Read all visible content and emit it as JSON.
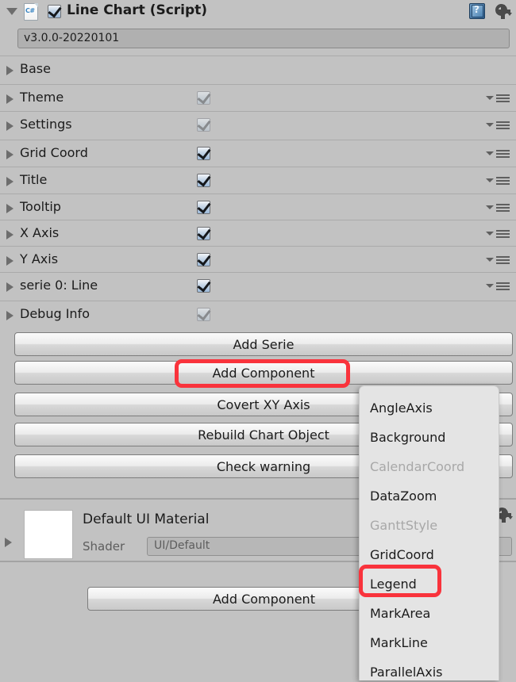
{
  "component": {
    "title": "Line Chart (Script)",
    "script_icon": "csharp-script-icon",
    "enabled": true,
    "help_icon": "help-book-icon",
    "settings_icon": "gear-icon",
    "version": "v3.0.0-20220101"
  },
  "foldouts": [
    {
      "label": "Base",
      "has_checkbox": false,
      "checked": false,
      "dim": false,
      "has_menu": false
    },
    {
      "label": "Theme",
      "has_checkbox": true,
      "checked": true,
      "dim": true,
      "has_menu": true
    },
    {
      "label": "Settings",
      "has_checkbox": true,
      "checked": true,
      "dim": true,
      "has_menu": true
    },
    {
      "label": "Grid Coord",
      "has_checkbox": true,
      "checked": true,
      "dim": false,
      "has_menu": true
    },
    {
      "label": "Title",
      "has_checkbox": true,
      "checked": true,
      "dim": false,
      "has_menu": true
    },
    {
      "label": "Tooltip",
      "has_checkbox": true,
      "checked": true,
      "dim": false,
      "has_menu": true
    },
    {
      "label": "X Axis",
      "has_checkbox": true,
      "checked": true,
      "dim": false,
      "has_menu": true
    },
    {
      "label": "Y Axis",
      "has_checkbox": true,
      "checked": true,
      "dim": false,
      "has_menu": true
    },
    {
      "label": "serie 0: Line",
      "has_checkbox": true,
      "checked": true,
      "dim": false,
      "has_menu": true
    },
    {
      "label": "Debug Info",
      "has_checkbox": true,
      "checked": true,
      "dim": true,
      "has_menu": false
    }
  ],
  "buttons": [
    {
      "label": "Add Serie"
    },
    {
      "label": "Add Component"
    },
    {
      "label": "Covert XY Axis"
    },
    {
      "label": "Rebuild Chart Object"
    },
    {
      "label": "Check warning"
    }
  ],
  "material": {
    "name": "Default UI Material",
    "shader_label": "Shader",
    "shader_value": "UI/Default",
    "settings_icon": "gear-icon"
  },
  "bottom": {
    "add_component_label": "Add Component"
  },
  "dropdown": {
    "items": [
      {
        "label": "AngleAxis",
        "disabled": false
      },
      {
        "label": "Background",
        "disabled": false
      },
      {
        "label": "CalendarCoord",
        "disabled": true
      },
      {
        "label": "DataZoom",
        "disabled": false
      },
      {
        "label": "GanttStyle",
        "disabled": true
      },
      {
        "label": "GridCoord",
        "disabled": false
      },
      {
        "label": "Legend",
        "disabled": false
      },
      {
        "label": "MarkArea",
        "disabled": false
      },
      {
        "label": "MarkLine",
        "disabled": false
      },
      {
        "label": "ParallelAxis",
        "disabled": false
      }
    ]
  },
  "annotations": {
    "highlight_color": "#f9333c",
    "highlighted": [
      "Add Component",
      "Legend"
    ]
  }
}
